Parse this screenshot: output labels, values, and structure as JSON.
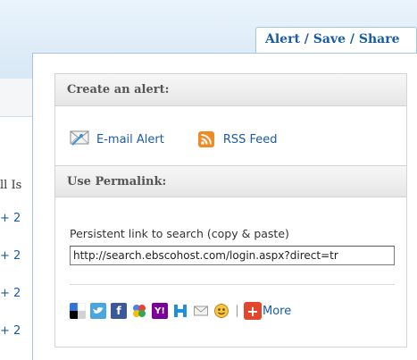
{
  "tab": {
    "label": "Alert / Save / Share"
  },
  "background": {
    "left_text": "ll Is",
    "plus_items": [
      "+ 2",
      "+ 2",
      "+ 2",
      "+ 2"
    ]
  },
  "alert_section": {
    "heading": "Create an alert:",
    "email_label": "E-mail Alert",
    "rss_label": "RSS Feed"
  },
  "permalink_section": {
    "heading": "Use Permalink:",
    "label": "Persistent link to search (copy & paste)",
    "url": "http://search.ebscohost.com/login.aspx?direct=tr"
  },
  "share": {
    "icons": [
      "delicious-icon",
      "twitter-icon",
      "facebook-icon",
      "google-icon",
      "yahoo-icon",
      "hyves-icon",
      "email-icon",
      "smiley-icon"
    ],
    "more_symbol": "+",
    "more_label": "More"
  },
  "colors": {
    "link": "#1a5ba3",
    "panel_border": "#a8c4df",
    "rss": "#f08a24",
    "more": "#e2462c"
  }
}
